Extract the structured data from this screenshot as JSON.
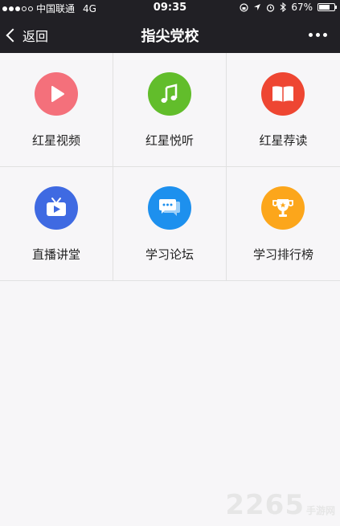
{
  "status_bar": {
    "carrier": "中国联通",
    "network": "4G",
    "time": "09:35",
    "battery": "67%",
    "battery_level": 0.67
  },
  "nav": {
    "back_label": "返回",
    "title": "指尖党校"
  },
  "tiles": [
    {
      "label": "红星视频",
      "icon": "play-icon",
      "color": "#f4707b"
    },
    {
      "label": "红星悦听",
      "icon": "music-note-icon",
      "color": "#62bd2b"
    },
    {
      "label": "红星荐读",
      "icon": "book-icon",
      "color": "#ee4632"
    },
    {
      "label": "直播讲堂",
      "icon": "tv-icon",
      "color": "#3f6ae2"
    },
    {
      "label": "学习论坛",
      "icon": "chat-bubbles-icon",
      "color": "#1d90ee"
    },
    {
      "label": "学习排行榜",
      "icon": "trophy-icon",
      "color": "#fca61b"
    }
  ],
  "watermark": {
    "number": "2265",
    "text": "手游网"
  }
}
